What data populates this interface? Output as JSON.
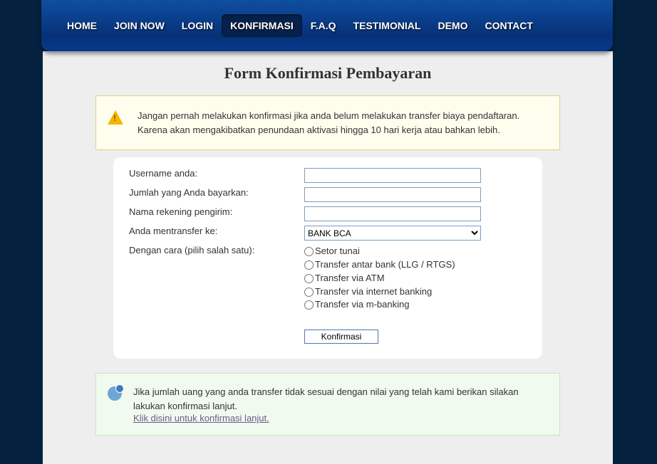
{
  "nav": {
    "items": [
      {
        "label": "HOME",
        "active": false
      },
      {
        "label": "JOIN NOW",
        "active": false
      },
      {
        "label": "LOGIN",
        "active": false
      },
      {
        "label": "KONFIRMASI",
        "active": true
      },
      {
        "label": "F.A.Q",
        "active": false
      },
      {
        "label": "TESTIMONIAL",
        "active": false
      },
      {
        "label": "DEMO",
        "active": false
      },
      {
        "label": "CONTACT",
        "active": false
      }
    ]
  },
  "page": {
    "title": "Form Konfirmasi Pembayaran"
  },
  "warning": {
    "text": "Jangan pernah melakukan konfirmasi jika anda belum melakukan transfer biaya pendaftaran. Karena akan mengakibatkan penundaan aktivasi hingga 10 hari kerja atau bahkan lebih."
  },
  "form": {
    "labels": {
      "username": "Username anda:",
      "amount": "Jumlah yang Anda bayarkan:",
      "account_name": "Nama rekening pengirim:",
      "transfer_to": "Anda mentransfer ke:",
      "method": "Dengan cara (pilih salah satu):"
    },
    "values": {
      "username": "",
      "amount": "",
      "account_name": ""
    },
    "bank_options": [
      "BANK BCA"
    ],
    "bank_selected": "BANK BCA",
    "methods": [
      "Setor tunai",
      "Transfer antar bank (LLG / RTGS)",
      "Transfer via ATM",
      "Transfer via internet banking",
      "Transfer via m-banking"
    ],
    "submit_label": "Konfirmasi"
  },
  "info": {
    "text": "Jika jumlah uang yang anda transfer tidak sesuai dengan nilai yang telah kami berikan silakan lakukan konfirmasi lanjut.",
    "link_text": "Klik disini untuk konfirmasi lanjut."
  }
}
